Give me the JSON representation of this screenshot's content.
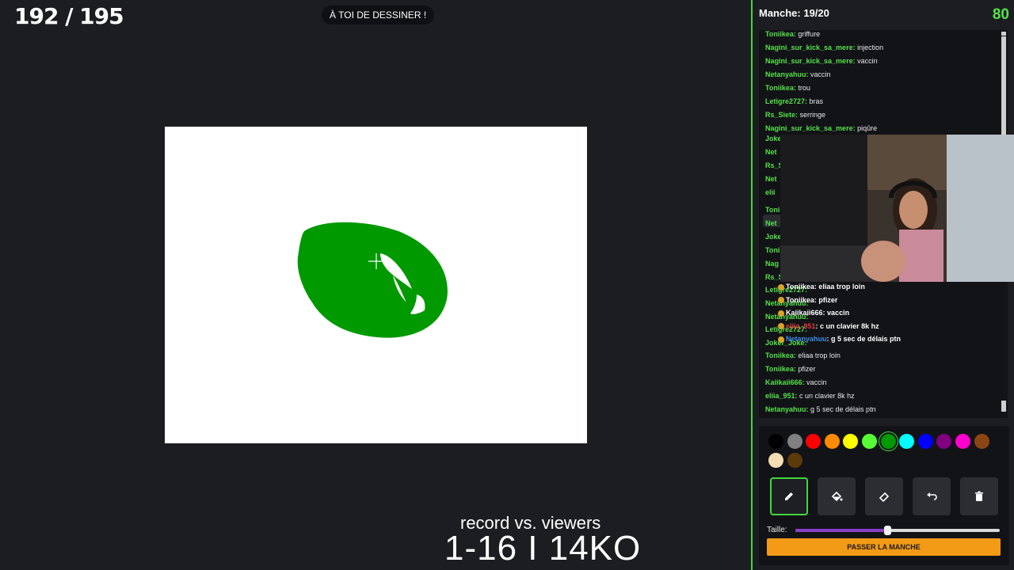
{
  "hud": {
    "score": "192 / 195",
    "turn_message": "À TOI DE DESSINER !"
  },
  "overlay": {
    "record_label": "record vs. viewers",
    "record_score": "1-16 I 14KO"
  },
  "sidebar": {
    "round_label": "Manche: 19/20",
    "timer": "80",
    "chat": [
      {
        "user": "Toniikea",
        "text": "griffure"
      },
      {
        "user": "Nagini_sur_kick_sa_mere",
        "text": "injection"
      },
      {
        "user": "Nagini_sur_kick_sa_mere",
        "text": "vaccin"
      },
      {
        "user": "Netanyahuu",
        "text": "vaccin"
      },
      {
        "user": "Toniikea",
        "text": "trou"
      },
      {
        "user": "Letigre2727",
        "text": "bras"
      },
      {
        "user": "Rs_Siete",
        "text": "serringe"
      },
      {
        "user": "Nagini_sur_kick_sa_mere",
        "text": "piqûre"
      },
      {
        "user": "Toniikea",
        "text": "eliaa trop loin"
      },
      {
        "user": "Toniikea",
        "text": "pfizer"
      },
      {
        "user": "Kaiikaii666",
        "text": "vaccin"
      },
      {
        "user": "eliia_951",
        "text": "c un clavier 8k hz"
      },
      {
        "user": "Netanyahuu",
        "text": "g 5 sec de délais ptn"
      }
    ],
    "obscured_rows": [
      "Joke",
      "Net",
      "Rs_S",
      "Net",
      "elii",
      "Toni",
      "Net",
      "Joke",
      "Toni",
      "Nag",
      "Rs_S",
      "Letigre2727:",
      "Netanyahuu:",
      "Netanyahuu:",
      "Letigre2727:",
      "Joker_Joke:"
    ],
    "overlay_chat": [
      {
        "user": "Toniikea",
        "text": "eliaa trop loin",
        "color": "#ffffff"
      },
      {
        "user": "Toniikea",
        "text": "pfizer",
        "color": "#ffffff"
      },
      {
        "user": "Kaiikaii666",
        "text": "vaccin",
        "color": "#ffffff"
      },
      {
        "user": "eliia_951",
        "text": "c un clavier 8k hz",
        "color": "#e63a3a"
      },
      {
        "user": "Netanyahuu",
        "text": "g 5 sec de délais ptn",
        "color": "#3a8ee6"
      }
    ]
  },
  "tools": {
    "palette": [
      "#000000",
      "#808080",
      "#ff0000",
      "#ff8c00",
      "#ffff00",
      "#55ff33",
      "#009900",
      "#00ffff",
      "#0000ff",
      "#800080",
      "#ff00cc",
      "#8b4513",
      "#f5deb3",
      "#5c3a0a"
    ],
    "selected_color": "#009900",
    "buttons": [
      "pencil-icon",
      "fill-bucket-icon",
      "eraser-icon",
      "undo-icon",
      "trash-icon"
    ],
    "active_tool": "pencil-icon",
    "size_label": "Taille:",
    "size_value": 0.45,
    "skip_label": "PASSER LA MANCHE"
  }
}
